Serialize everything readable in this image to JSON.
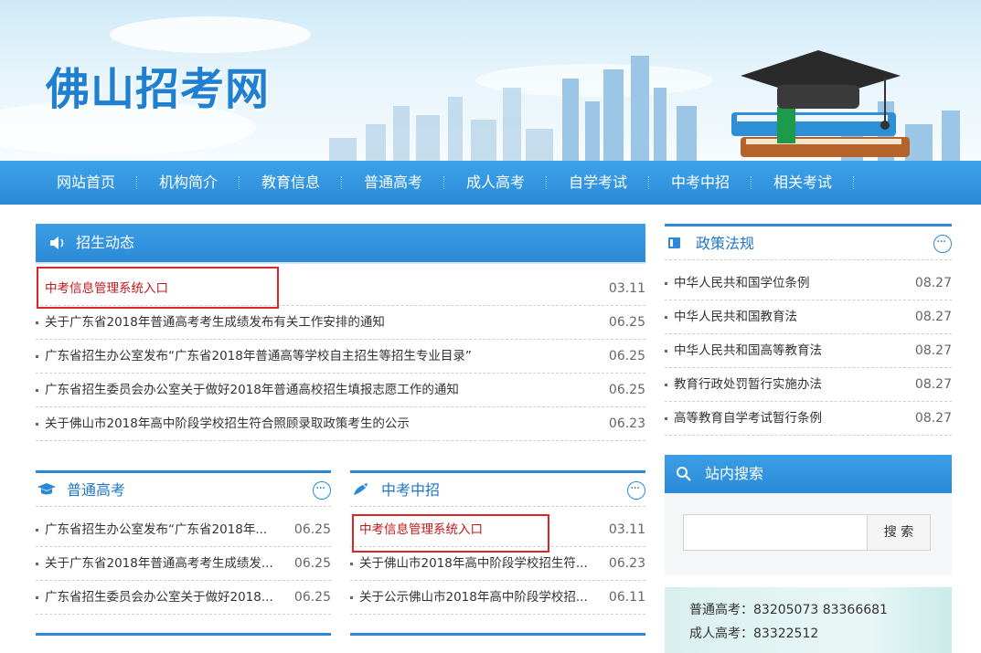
{
  "header": {
    "logo_text": "佛山招考网"
  },
  "nav": {
    "items": [
      "网站首页",
      "机构简介",
      "教育信息",
      "普通高考",
      "成人高考",
      "自学考试",
      "中考中招",
      "相关考试"
    ]
  },
  "admission_news": {
    "title": "招生动态",
    "items": [
      {
        "title": "中考信息管理系统入口",
        "date": "03.11"
      },
      {
        "title": "关于广东省2018年普通高考考生成绩发布有关工作安排的通知",
        "date": "06.25"
      },
      {
        "title": "广东省招生办公室发布“广东省2018年普通高等学校自主招生等招生专业目录”",
        "date": "06.25"
      },
      {
        "title": "广东省招生委员会办公室关于做好2018年普通高校招生填报志愿工作的通知",
        "date": "06.25"
      },
      {
        "title": "关于佛山市2018年高中阶段学校招生符合照顾录取政策考生的公示",
        "date": "06.23"
      }
    ]
  },
  "policy": {
    "title": "政策法规",
    "items": [
      {
        "title": "中华人民共和国学位条例",
        "date": "08.27"
      },
      {
        "title": "中华人民共和国教育法",
        "date": "08.27"
      },
      {
        "title": "中华人民共和国高等教育法",
        "date": "08.27"
      },
      {
        "title": "教育行政处罚暂行实施办法",
        "date": "08.27"
      },
      {
        "title": "高等教育自学考试暂行条例",
        "date": "08.27"
      }
    ]
  },
  "gaokao": {
    "title": "普通高考",
    "items": [
      {
        "title": "广东省招生办公室发布“广东省2018年...",
        "date": "06.25"
      },
      {
        "title": "关于广东省2018年普通高考考生成绩发...",
        "date": "06.25"
      },
      {
        "title": "广东省招生委员会办公室关于做好2018...",
        "date": "06.25"
      }
    ]
  },
  "zhongkao": {
    "title": "中考中招",
    "items": [
      {
        "title": "中考信息管理系统入口",
        "date": "03.11"
      },
      {
        "title": "关于佛山市2018年高中阶段学校招生符...",
        "date": "06.23"
      },
      {
        "title": "关于公示佛山市2018年高中阶段学校招...",
        "date": "06.11"
      }
    ]
  },
  "search": {
    "title": "站内搜索",
    "button": "搜 索",
    "placeholder": ""
  },
  "contact": {
    "lines": [
      "普通高考：83205073 83366681",
      "成人高考：83322512"
    ]
  },
  "colors": {
    "brand_blue": "#2b8ad7",
    "highlight_red": "#c0191c",
    "box_red": "#d9262b"
  }
}
